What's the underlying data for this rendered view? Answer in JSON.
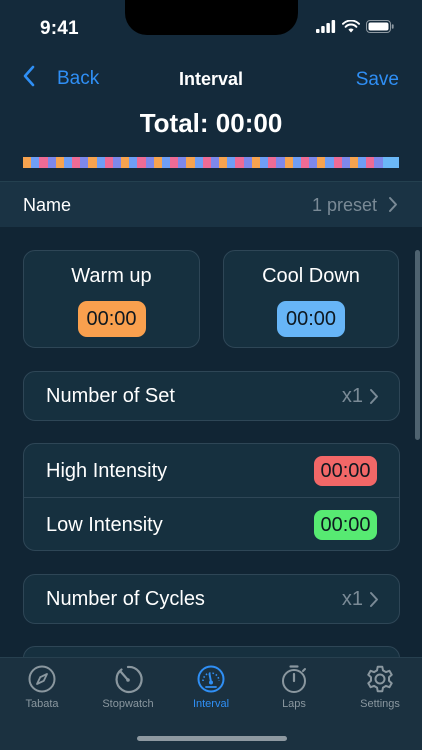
{
  "status_bar": {
    "time": "9:41"
  },
  "nav": {
    "back_label": "Back",
    "title": "Interval",
    "save_label": "Save"
  },
  "total": {
    "label": "Total: 00:00"
  },
  "segment_colors": [
    "#f7a34f",
    "#6f9ef5",
    "#ee6b95",
    "#7e88ea",
    "#f7a34f",
    "#6f9ef5",
    "#ee6b95",
    "#7e88ea",
    "#f7a34f",
    "#6f9ef5",
    "#ee6b95",
    "#7e88ea",
    "#f7a34f",
    "#6f9ef5",
    "#ee6b95",
    "#7e88ea",
    "#f7a34f",
    "#6f9ef5",
    "#ee6b95",
    "#7e88ea",
    "#f7a34f",
    "#6f9ef5",
    "#ee6b95",
    "#7e88ea",
    "#f7a34f",
    "#6f9ef5",
    "#ee6b95",
    "#7e88ea",
    "#f7a34f",
    "#6f9ef5",
    "#ee6b95",
    "#7e88ea",
    "#f7a34f",
    "#6f9ef5",
    "#ee6b95",
    "#7e88ea",
    "#f7a34f",
    "#6f9ef5",
    "#ee6b95",
    "#7e88ea",
    "#f7a34f",
    "#6f9ef5",
    "#ee6b95",
    "#7e88ea",
    "#6bb8f7",
    "#6bb8f7"
  ],
  "name_row": {
    "label": "Name",
    "value": "1 preset"
  },
  "warm_up": {
    "title": "Warm up",
    "time": "00:00"
  },
  "cool_down": {
    "title": "Cool Down",
    "time": "00:00"
  },
  "sets": {
    "label": "Number of Set",
    "value": "x1"
  },
  "high_intensity": {
    "label": "High Intensity",
    "time": "00:00"
  },
  "low_intensity": {
    "label": "Low Intensity",
    "time": "00:00"
  },
  "cycles": {
    "label": "Number of Cycles",
    "value": "x1"
  },
  "tabs": [
    {
      "label": "Tabata",
      "icon": "compass-icon",
      "active": false
    },
    {
      "label": "Stopwatch",
      "icon": "stopwatch-icon",
      "active": false
    },
    {
      "label": "Interval",
      "icon": "gauge-icon",
      "active": true
    },
    {
      "label": "Laps",
      "icon": "timer-icon",
      "active": false
    },
    {
      "label": "Settings",
      "icon": "gear-icon",
      "active": false
    }
  ],
  "colors": {
    "accent": "#2f8ff5",
    "warm_up": "#f9a04e",
    "cool_down": "#67b5f7",
    "high_intensity": "#f26767",
    "low_intensity": "#57ea72"
  }
}
